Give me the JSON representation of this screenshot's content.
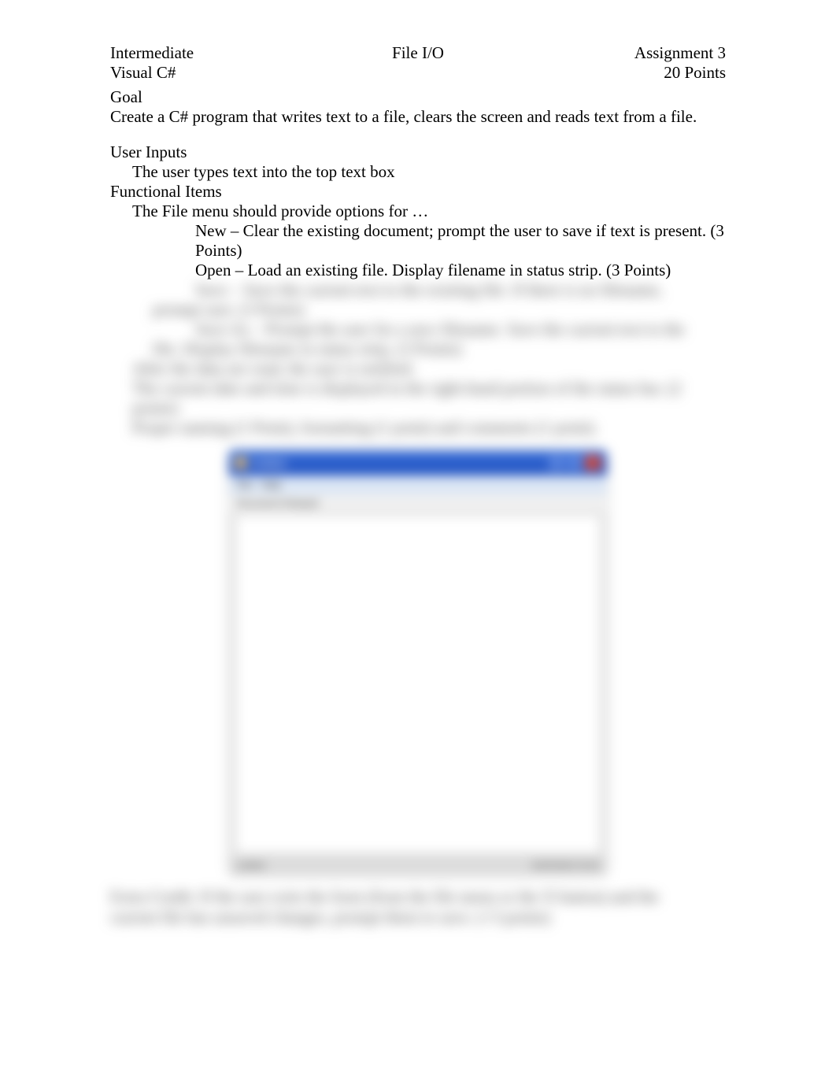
{
  "header": {
    "left_line1": "Intermediate",
    "left_line2": "Visual C#",
    "center": "File I/O",
    "right_line1": "Assignment 3",
    "right_line2": "20 Points"
  },
  "goal": {
    "title": "Goal",
    "text": "Create a C# program that writes text to a file, clears the screen and reads text from a file."
  },
  "user_inputs": {
    "title": "User Inputs",
    "items": [
      "The user types text into the top text box"
    ]
  },
  "functional": {
    "title": "Functional Items",
    "intro": "The File menu should provide options for …",
    "subitems": [
      "New – Clear the existing document; prompt the user to save if text is present. (3 Points)",
      "Open – Load an existing file.  Display filename in status strip. (3 Points)"
    ]
  },
  "blurred": {
    "line1": "Save – Save the current text to the existing file. If there is no filename,",
    "line2": "prompt user. (3 Points)",
    "line3": "Save As – Prompt the user for a new filename. Save the current text to the",
    "line4": "file. Display filename in status strip. (3 Points)",
    "line5": "After the data are read, the user is notified.",
    "line6": "The current date and time is displayed in the right-hand portion of the status bar. (2",
    "line7": "points)",
    "line8": "Proper naming (1 Point), formatting (1 point) and comments (1 point)."
  },
  "app": {
    "title": "Untitled",
    "menu_file": "File",
    "menu_help": "Help",
    "doc_label": "Document Notepad",
    "status_left": "untitled",
    "status_right": "00/00/0000 00:00"
  },
  "footer_blur": {
    "line1": "Extra Credit: If the user exits the form (from the file menu or the X button) and the",
    "line2": "current file has unsaved changes, prompt them to save. (+3 points)"
  },
  "bullets": {
    "outer": "",
    "inner": ""
  }
}
